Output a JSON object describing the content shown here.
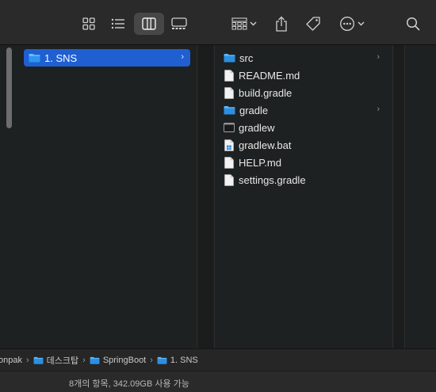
{
  "toolbar": {
    "icons": [
      "icon-view-grid",
      "list-view-icon",
      "column-view-icon",
      "gallery-view-icon",
      "group-icon",
      "share-icon",
      "tag-icon",
      "more-icon",
      "search-icon"
    ],
    "active_view": "columns"
  },
  "columns": {
    "parent": {
      "selected_item": {
        "label": "1. SNS",
        "type": "folder"
      }
    },
    "contents": {
      "items": [
        {
          "label": "src",
          "type": "folder",
          "has_children": true
        },
        {
          "label": "README.md",
          "type": "file"
        },
        {
          "label": "build.gradle",
          "type": "file"
        },
        {
          "label": "gradle",
          "type": "folder",
          "has_children": true
        },
        {
          "label": "gradlew",
          "type": "executable"
        },
        {
          "label": "gradlew.bat",
          "type": "file"
        },
        {
          "label": "HELP.md",
          "type": "file"
        },
        {
          "label": "settings.gradle",
          "type": "file"
        }
      ]
    }
  },
  "pathbar": {
    "crumbs": [
      {
        "label": "onpak",
        "has_icon": false
      },
      {
        "label": "데스크탑",
        "has_icon": true
      },
      {
        "label": "SpringBoot",
        "has_icon": true
      },
      {
        "label": "1. SNS",
        "has_icon": true
      }
    ]
  },
  "status": {
    "text": "8개의 항목, 342.09GB 사용 가능"
  },
  "colors": {
    "accent": "#1f5fd1",
    "folder": "#3aa0f0",
    "background": "#1e2121"
  }
}
